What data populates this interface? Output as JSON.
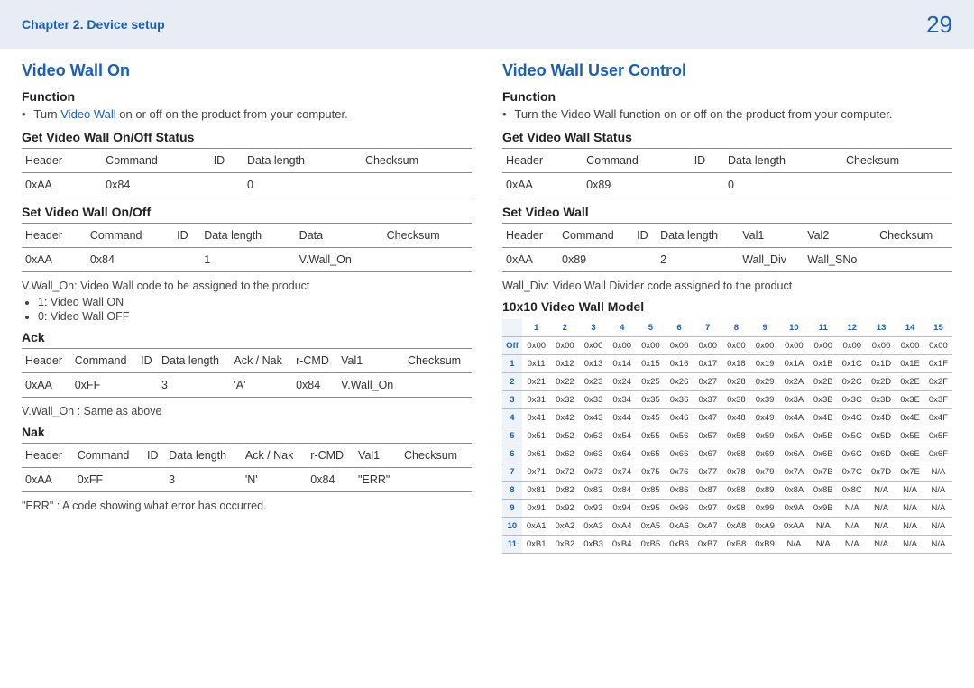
{
  "header": {
    "chapter": "Chapter 2. Device setup",
    "page": "29"
  },
  "left": {
    "title": "Video Wall On",
    "function_h": "Function",
    "function_pre": "Turn ",
    "function_accent": "Video Wall",
    "function_post": " on or off on the product from your computer.",
    "get_h": "Get Video Wall On/Off Status",
    "get_head": [
      "Header",
      "Command",
      "ID",
      "Data length",
      "Checksum"
    ],
    "get_row": [
      "0xAA",
      "0x84",
      "",
      "0",
      ""
    ],
    "set_h": "Set Video Wall On/Off",
    "set_head": [
      "Header",
      "Command",
      "ID",
      "Data length",
      "Data",
      "Checksum"
    ],
    "set_row": [
      "0xAA",
      "0x84",
      "",
      "1",
      "V.Wall_On",
      ""
    ],
    "set_note": "V.Wall_On: Video Wall code to be assigned to the product",
    "set_vals": [
      "1: Video Wall ON",
      "0: Video Wall OFF"
    ],
    "ack_h": "Ack",
    "ack_head": [
      "Header",
      "Command",
      "ID",
      "Data length",
      "Ack / Nak",
      "r-CMD",
      "Val1",
      "Checksum"
    ],
    "ack_row": [
      "0xAA",
      "0xFF",
      "",
      "3",
      "'A'",
      "0x84",
      "V.Wall_On",
      ""
    ],
    "ack_note": "V.Wall_On : Same as above",
    "nak_h": "Nak",
    "nak_head": [
      "Header",
      "Command",
      "ID",
      "Data length",
      "Ack / Nak",
      "r-CMD",
      "Val1",
      "Checksum"
    ],
    "nak_row": [
      "0xAA",
      "0xFF",
      "",
      "3",
      "'N'",
      "0x84",
      "\"ERR\"",
      ""
    ],
    "nak_note": "\"ERR\" : A code showing what error has occurred."
  },
  "right": {
    "title": "Video Wall User Control",
    "function_h": "Function",
    "function_text": "Turn the Video Wall function on or off on the product from your computer.",
    "get_h": "Get Video Wall Status",
    "get_head": [
      "Header",
      "Command",
      "ID",
      "Data length",
      "Checksum"
    ],
    "get_row": [
      "0xAA",
      "0x89",
      "",
      "0",
      ""
    ],
    "set_h": "Set Video Wall",
    "set_head": [
      "Header",
      "Command",
      "ID",
      "Data length",
      "Val1",
      "Val2",
      "Checksum"
    ],
    "set_row": [
      "0xAA",
      "0x89",
      "",
      "2",
      "Wall_Div",
      "Wall_SNo",
      ""
    ],
    "set_note": "Wall_Div: Video Wall Divider code assigned to the product",
    "model_h": "10x10 Video Wall Model",
    "matrix_cols": [
      "1",
      "2",
      "3",
      "4",
      "5",
      "6",
      "7",
      "8",
      "9",
      "10",
      "11",
      "12",
      "13",
      "14",
      "15"
    ],
    "matrix_rowhead": [
      "Off",
      "1",
      "2",
      "3",
      "4",
      "5",
      "6",
      "7",
      "8",
      "9",
      "10",
      "11"
    ],
    "matrix": [
      [
        "0x00",
        "0x00",
        "0x00",
        "0x00",
        "0x00",
        "0x00",
        "0x00",
        "0x00",
        "0x00",
        "0x00",
        "0x00",
        "0x00",
        "0x00",
        "0x00",
        "0x00"
      ],
      [
        "0x11",
        "0x12",
        "0x13",
        "0x14",
        "0x15",
        "0x16",
        "0x17",
        "0x18",
        "0x19",
        "0x1A",
        "0x1B",
        "0x1C",
        "0x1D",
        "0x1E",
        "0x1F"
      ],
      [
        "0x21",
        "0x22",
        "0x23",
        "0x24",
        "0x25",
        "0x26",
        "0x27",
        "0x28",
        "0x29",
        "0x2A",
        "0x2B",
        "0x2C",
        "0x2D",
        "0x2E",
        "0x2F"
      ],
      [
        "0x31",
        "0x32",
        "0x33",
        "0x34",
        "0x35",
        "0x36",
        "0x37",
        "0x38",
        "0x39",
        "0x3A",
        "0x3B",
        "0x3C",
        "0x3D",
        "0x3E",
        "0x3F"
      ],
      [
        "0x41",
        "0x42",
        "0x43",
        "0x44",
        "0x45",
        "0x46",
        "0x47",
        "0x48",
        "0x49",
        "0x4A",
        "0x4B",
        "0x4C",
        "0x4D",
        "0x4E",
        "0x4F"
      ],
      [
        "0x51",
        "0x52",
        "0x53",
        "0x54",
        "0x55",
        "0x56",
        "0x57",
        "0x58",
        "0x59",
        "0x5A",
        "0x5B",
        "0x5C",
        "0x5D",
        "0x5E",
        "0x5F"
      ],
      [
        "0x61",
        "0x62",
        "0x63",
        "0x64",
        "0x65",
        "0x66",
        "0x67",
        "0x68",
        "0x69",
        "0x6A",
        "0x6B",
        "0x6C",
        "0x6D",
        "0x6E",
        "0x6F"
      ],
      [
        "0x71",
        "0x72",
        "0x73",
        "0x74",
        "0x75",
        "0x76",
        "0x77",
        "0x78",
        "0x79",
        "0x7A",
        "0x7B",
        "0x7C",
        "0x7D",
        "0x7E",
        "N/A"
      ],
      [
        "0x81",
        "0x82",
        "0x83",
        "0x84",
        "0x85",
        "0x86",
        "0x87",
        "0x88",
        "0x89",
        "0x8A",
        "0x8B",
        "0x8C",
        "N/A",
        "N/A",
        "N/A"
      ],
      [
        "0x91",
        "0x92",
        "0x93",
        "0x94",
        "0x95",
        "0x96",
        "0x97",
        "0x98",
        "0x99",
        "0x9A",
        "0x9B",
        "N/A",
        "N/A",
        "N/A",
        "N/A"
      ],
      [
        "0xA1",
        "0xA2",
        "0xA3",
        "0xA4",
        "0xA5",
        "0xA6",
        "0xA7",
        "0xA8",
        "0xA9",
        "0xAA",
        "N/A",
        "N/A",
        "N/A",
        "N/A",
        "N/A"
      ],
      [
        "0xB1",
        "0xB2",
        "0xB3",
        "0xB4",
        "0xB5",
        "0xB6",
        "0xB7",
        "0xB8",
        "0xB9",
        "N/A",
        "N/A",
        "N/A",
        "N/A",
        "N/A",
        "N/A"
      ]
    ]
  }
}
